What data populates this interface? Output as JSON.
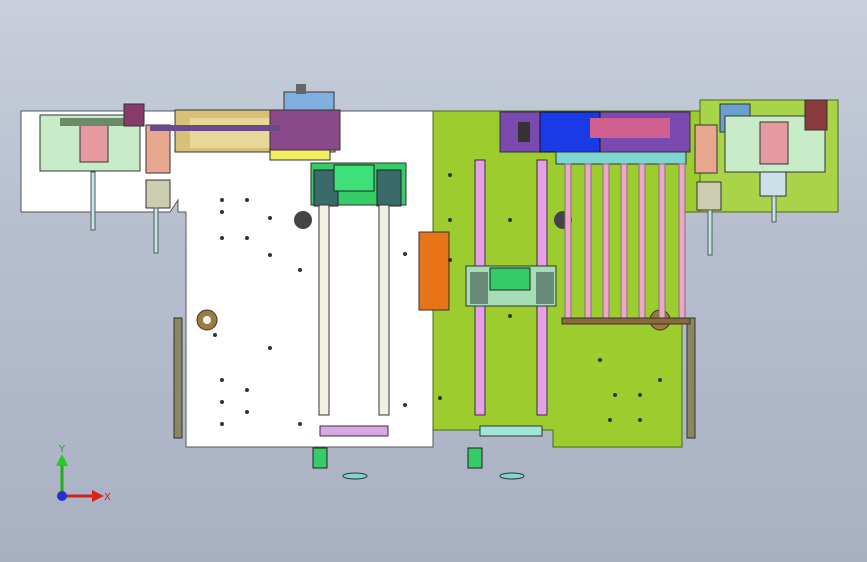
{
  "triad": {
    "x_label": "X",
    "y_label": "Y"
  },
  "colors": {
    "left_plate": "#ffffff",
    "right_plate": "#9ccc2e",
    "rail": "#e6a0e6",
    "carriage": "#33cc66",
    "orange_block": "#e8741a",
    "pneumatic_rod": "#f0a6c8",
    "blue_part": "#1a3ae6",
    "teal_bar": "#7fd6d0"
  }
}
